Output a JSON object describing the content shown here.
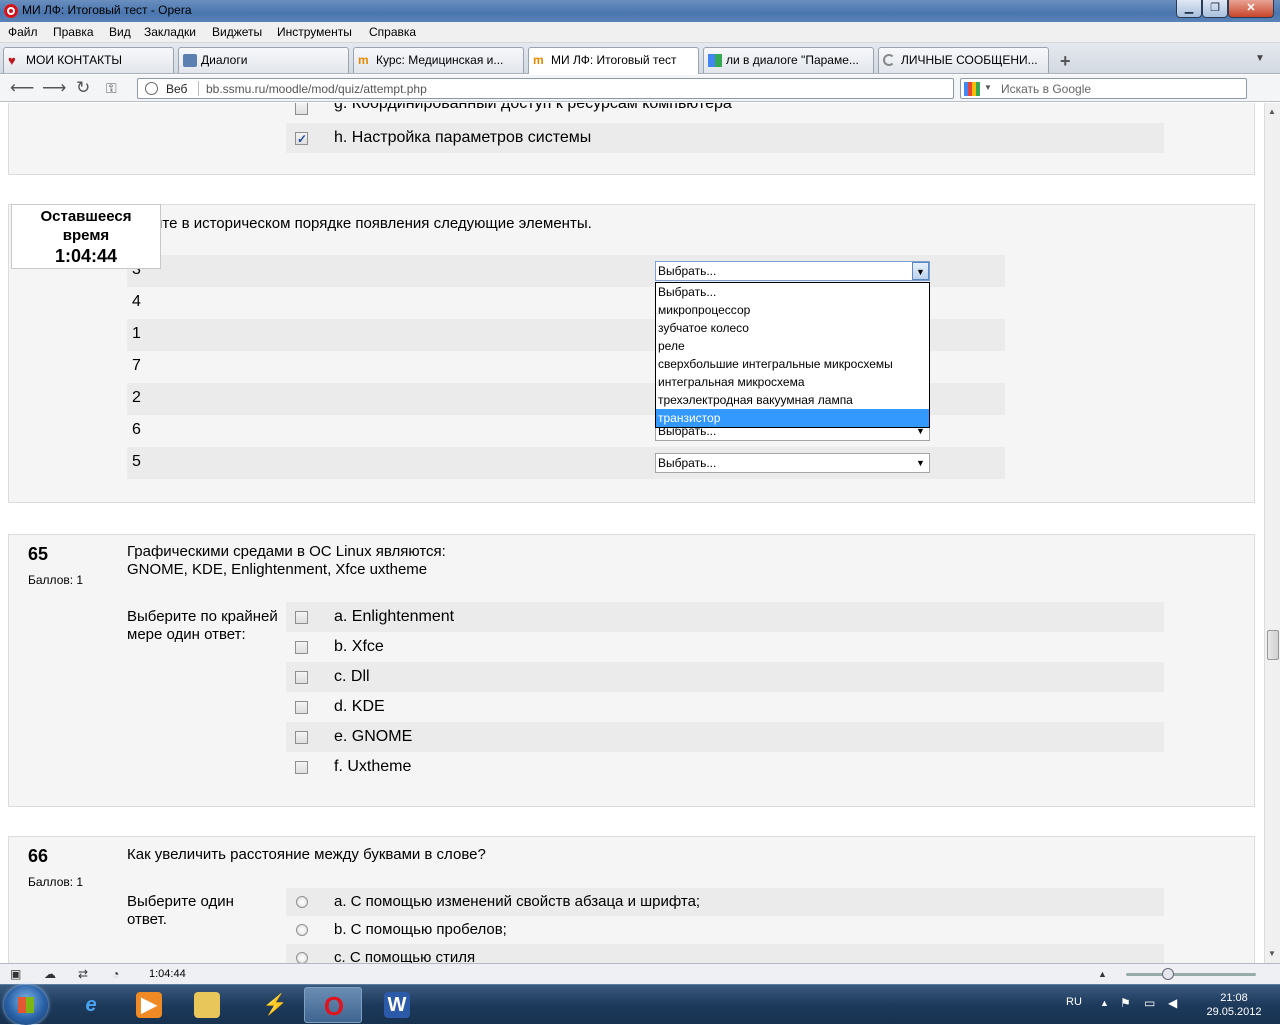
{
  "window": {
    "title": "МИ ЛФ: Итоговый тест - Opera"
  },
  "menu": [
    "Файл",
    "Правка",
    "Вид",
    "Закладки",
    "Виджеты",
    "Инструменты",
    "Справка"
  ],
  "tabs": [
    {
      "label": "МОИ КОНТАКТЫ",
      "icon": "red-heart-icon"
    },
    {
      "label": "Диалоги",
      "icon": "chat-icon"
    },
    {
      "label": "Курс: Медицинская и...",
      "icon": "moodle-icon"
    },
    {
      "label": "МИ ЛФ: Итоговый тест",
      "icon": "moodle-icon",
      "active": true
    },
    {
      "label": "ли в диалоге \"Параме...",
      "icon": "google-icon"
    },
    {
      "label": "ЛИЧНЫЕ СООБЩЕНИ...",
      "icon": "loading-icon"
    }
  ],
  "address": {
    "web_label": "Веб",
    "url": "bb.ssmu.ru/moodle/mod/quiz/attempt.php"
  },
  "search": {
    "placeholder": "Искать в Google"
  },
  "timer": {
    "label_line1": "Оставшееся",
    "label_line2": "время",
    "value": "1:04:44"
  },
  "q63": {
    "options": [
      {
        "label": "g. Координированный доступ к ресурсам компьютера",
        "checked": false
      },
      {
        "label": "h. Настройка параметров системы",
        "checked": true
      }
    ]
  },
  "q64": {
    "text": "ите в историческом порядке появления следующие элементы.",
    "rows": [
      {
        "num": "3",
        "value": "Выбрать..."
      },
      {
        "num": "4",
        "value": "Выбрать..."
      },
      {
        "num": "1",
        "value": "Выбрать..."
      },
      {
        "num": "7",
        "value": "Выбрать..."
      },
      {
        "num": "2",
        "value": "Выбрать..."
      },
      {
        "num": "6",
        "value": "Выбрать..."
      },
      {
        "num": "5",
        "value": "Выбрать..."
      }
    ],
    "dropdown_options": [
      "Выбрать...",
      "микропроцессор",
      "зубчатое колесо",
      "реле",
      "сверхбольшие интегральные микросхемы",
      "интегральная микросхема",
      "трехэлектродная вакуумная лампа",
      "транзистор"
    ],
    "highlighted": "транзистор"
  },
  "q65": {
    "number": "65",
    "points": "Баллов: 1",
    "text_line1": "Графическими средами в ОС Linux являются:",
    "text_line2": "GNOME, KDE, Enlightenment, Xfce uxtheme",
    "prompt": "Выберите по крайней мере один ответ:",
    "options": [
      "a. Enlightenment",
      "b. Xfce",
      "c. Dll",
      "d. KDE",
      "e. GNOME",
      "f. Uxtheme"
    ]
  },
  "q66": {
    "number": "66",
    "points": "Баллов: 1",
    "text": "Как увеличить расстояние между буквами в слове?",
    "prompt": "Выберите один ответ.",
    "options": [
      "a. С помощью изменений свойств абзаца и шрифта;",
      "b. С помощью пробелов;",
      "c. С помощью стиля"
    ]
  },
  "status": {
    "time": "1:04:44"
  },
  "tray": {
    "lang": "RU",
    "time": "21:08",
    "date": "29.05.2012"
  }
}
